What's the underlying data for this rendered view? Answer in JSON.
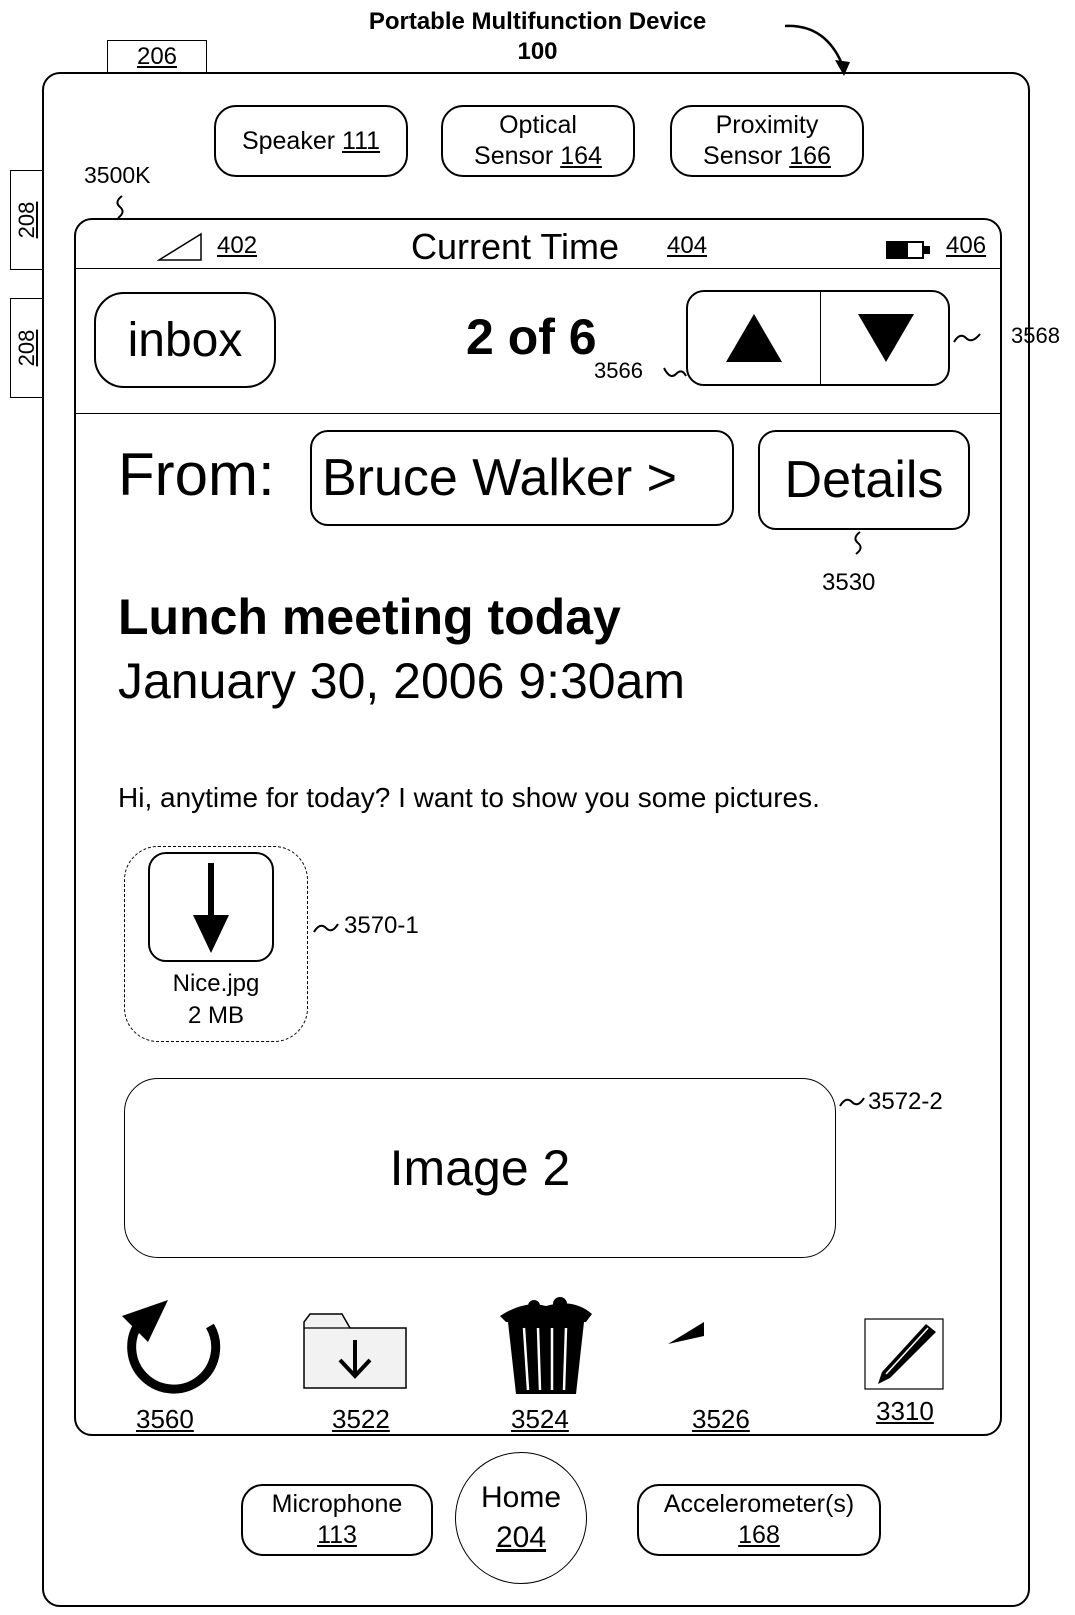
{
  "header": {
    "title": "Portable Multifunction Device",
    "number": "100"
  },
  "device": {
    "top_ref": "206",
    "side_refs": [
      "208",
      "208"
    ],
    "sensors": [
      {
        "line1": "Speaker",
        "ref": "111"
      },
      {
        "line1": "Optical",
        "line2": "Sensor",
        "ref": "164"
      },
      {
        "line1": "Proximity",
        "line2": "Sensor",
        "ref": "166"
      }
    ],
    "bottom": {
      "microphone": {
        "label": "Microphone",
        "ref": "113"
      },
      "home": {
        "label": "Home",
        "ref": "204"
      },
      "accelerometer": {
        "label": "Accelerometer(s)",
        "ref": "168"
      }
    }
  },
  "screen": {
    "ref": "3500K",
    "status_bar": {
      "signal_ref": "402",
      "time_label": "Current Time",
      "time_ref": "404",
      "battery_ref": "406"
    },
    "nav": {
      "inbox_label": "inbox",
      "counter": "2 of 6",
      "counter_ref": "3566",
      "arrows_ref": "3568"
    },
    "message": {
      "from_label": "From:",
      "sender": "Bruce Walker >",
      "details_label": "Details",
      "details_ref": "3530",
      "subject": "Lunch meeting today",
      "date": "January 30, 2006 9:30am",
      "body": "Hi, anytime for today? I want to show you some pictures.",
      "attachment": {
        "name": "Nice.jpg",
        "size": "2 MB",
        "ref": "3570-1"
      },
      "image": {
        "label": "Image 2",
        "ref": "3572-2"
      }
    },
    "toolbar": [
      {
        "icon": "refresh-icon",
        "ref": "3560"
      },
      {
        "icon": "move-to-folder-icon",
        "ref": "3522"
      },
      {
        "icon": "trash-icon",
        "ref": "3524"
      },
      {
        "icon": "reply-icon",
        "ref": "3526"
      },
      {
        "icon": "compose-icon",
        "ref": "3310"
      }
    ]
  }
}
